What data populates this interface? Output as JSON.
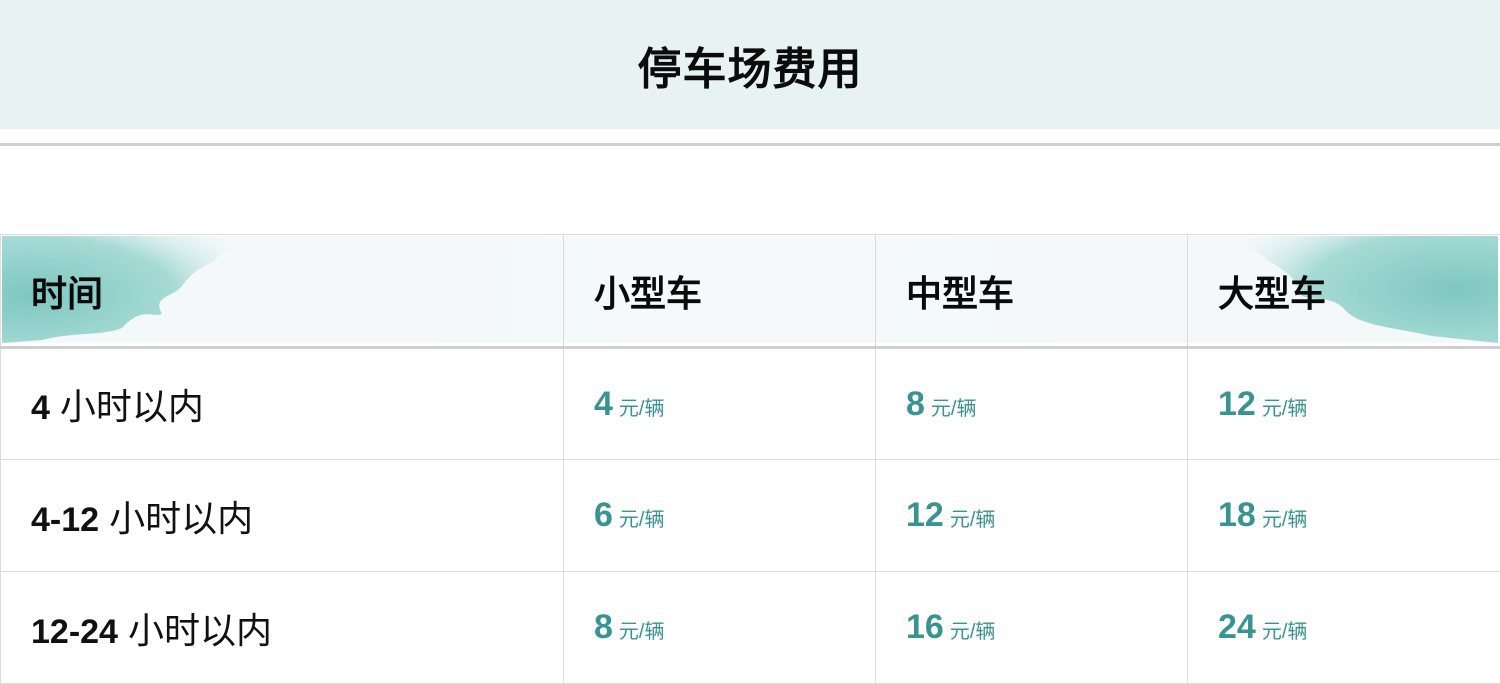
{
  "page": {
    "title": "停车场费用"
  },
  "table": {
    "headers": [
      "时间",
      "小型车",
      "中型车",
      "大型车"
    ],
    "rows": [
      {
        "time_num": "4",
        "time_text": " 小时以内",
        "prices": [
          {
            "value": "4",
            "unit": "元/辆"
          },
          {
            "value": "8",
            "unit": "元/辆"
          },
          {
            "value": "12",
            "unit": "元/辆"
          }
        ]
      },
      {
        "time_num": "4-12",
        "time_text": " 小时以内",
        "prices": [
          {
            "value": "6",
            "unit": "元/辆"
          },
          {
            "value": "12",
            "unit": "元/辆"
          },
          {
            "value": "18",
            "unit": "元/辆"
          }
        ]
      },
      {
        "time_num": "12-24",
        "time_text": " 小时以内",
        "prices": [
          {
            "value": "8",
            "unit": "元/辆"
          },
          {
            "value": "16",
            "unit": "元/辆"
          },
          {
            "value": "24",
            "unit": "元/辆"
          }
        ]
      }
    ]
  },
  "colors": {
    "header_bg": "#e7f3f3",
    "price_accent": "#3a9393",
    "watercolor": "#8fcfc9"
  }
}
